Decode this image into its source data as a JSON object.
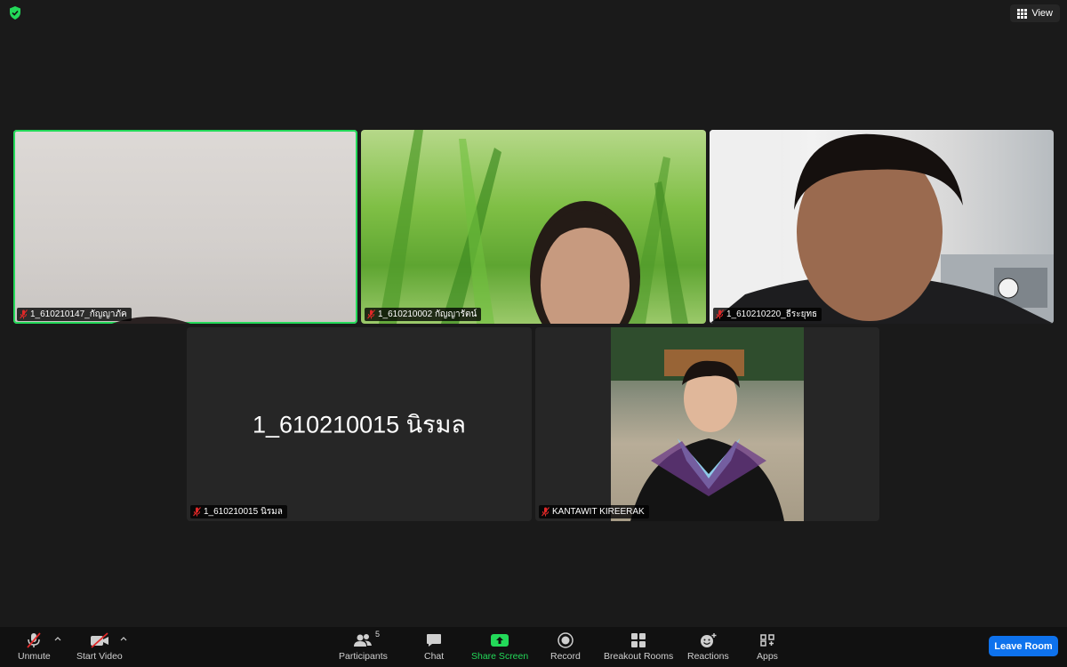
{
  "top": {
    "view_label": "View"
  },
  "participants": [
    {
      "name": "1_610210147_กัญญาภัค",
      "video": "on",
      "active": true
    },
    {
      "name": "1_610210002 กัญญารัตน์",
      "video": "on",
      "active": false
    },
    {
      "name": "1_610210220_ธีระยุทธ",
      "video": "on",
      "active": false
    },
    {
      "name": "1_610210015 นิรมล",
      "video": "off",
      "display_name": "1_610210015 นิรมล",
      "active": false
    },
    {
      "name": "KANTAWIT KIREERAK",
      "video": "photo",
      "active": false
    }
  ],
  "toolbar": {
    "unmute": "Unmute",
    "start_video": "Start Video",
    "participants": "Participants",
    "participants_count": "5",
    "chat": "Chat",
    "share_screen": "Share Screen",
    "record": "Record",
    "breakout_rooms": "Breakout Rooms",
    "reactions": "Reactions",
    "apps": "Apps",
    "leave": "Leave Room"
  },
  "colors": {
    "active_speaker": "#23d959",
    "leave_button": "#0e72ed",
    "muted_icon": "#e02828",
    "share_green": "#23d959"
  }
}
